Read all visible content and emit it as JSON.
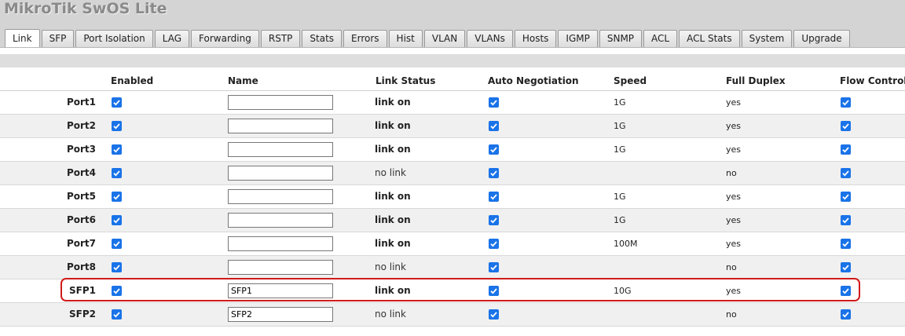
{
  "app": {
    "title": "MikroTik SwOS Lite"
  },
  "tabs": [
    {
      "label": "Link",
      "active": true
    },
    {
      "label": "SFP"
    },
    {
      "label": "Port Isolation"
    },
    {
      "label": "LAG"
    },
    {
      "label": "Forwarding"
    },
    {
      "label": "RSTP"
    },
    {
      "label": "Stats"
    },
    {
      "label": "Errors"
    },
    {
      "label": "Hist"
    },
    {
      "label": "VLAN"
    },
    {
      "label": "VLANs"
    },
    {
      "label": "Hosts"
    },
    {
      "label": "IGMP"
    },
    {
      "label": "SNMP"
    },
    {
      "label": "ACL"
    },
    {
      "label": "ACL Stats"
    },
    {
      "label": "System"
    },
    {
      "label": "Upgrade"
    }
  ],
  "table": {
    "headers": {
      "enabled": "Enabled",
      "name": "Name",
      "link_status": "Link Status",
      "auto_negotiation": "Auto Negotiation",
      "speed": "Speed",
      "full_duplex": "Full Duplex",
      "flow_control": "Flow Control"
    },
    "rows": [
      {
        "port": "Port1",
        "enabled": true,
        "name": "",
        "link_status": "link on",
        "auto_negotiation": true,
        "speed": "1G",
        "full_duplex": "yes",
        "flow_control": true
      },
      {
        "port": "Port2",
        "enabled": true,
        "name": "",
        "link_status": "link on",
        "auto_negotiation": true,
        "speed": "1G",
        "full_duplex": "yes",
        "flow_control": true
      },
      {
        "port": "Port3",
        "enabled": true,
        "name": "",
        "link_status": "link on",
        "auto_negotiation": true,
        "speed": "1G",
        "full_duplex": "yes",
        "flow_control": true
      },
      {
        "port": "Port4",
        "enabled": true,
        "name": "",
        "link_status": "no link",
        "auto_negotiation": true,
        "speed": "",
        "full_duplex": "no",
        "flow_control": true
      },
      {
        "port": "Port5",
        "enabled": true,
        "name": "",
        "link_status": "link on",
        "auto_negotiation": true,
        "speed": "1G",
        "full_duplex": "yes",
        "flow_control": true
      },
      {
        "port": "Port6",
        "enabled": true,
        "name": "",
        "link_status": "link on",
        "auto_negotiation": true,
        "speed": "1G",
        "full_duplex": "yes",
        "flow_control": true
      },
      {
        "port": "Port7",
        "enabled": true,
        "name": "",
        "link_status": "link on",
        "auto_negotiation": true,
        "speed": "100M",
        "full_duplex": "yes",
        "flow_control": true
      },
      {
        "port": "Port8",
        "enabled": true,
        "name": "",
        "link_status": "no link",
        "auto_negotiation": true,
        "speed": "",
        "full_duplex": "no",
        "flow_control": true
      },
      {
        "port": "SFP1",
        "enabled": true,
        "name": "SFP1",
        "link_status": "link on",
        "auto_negotiation": true,
        "speed": "10G",
        "full_duplex": "yes",
        "flow_control": true,
        "highlighted": true
      },
      {
        "port": "SFP2",
        "enabled": true,
        "name": "SFP2",
        "link_status": "no link",
        "auto_negotiation": true,
        "speed": "",
        "full_duplex": "no",
        "flow_control": true
      }
    ]
  },
  "colors": {
    "checkbox": "#1a73e8",
    "highlight": "#d11a1a"
  }
}
